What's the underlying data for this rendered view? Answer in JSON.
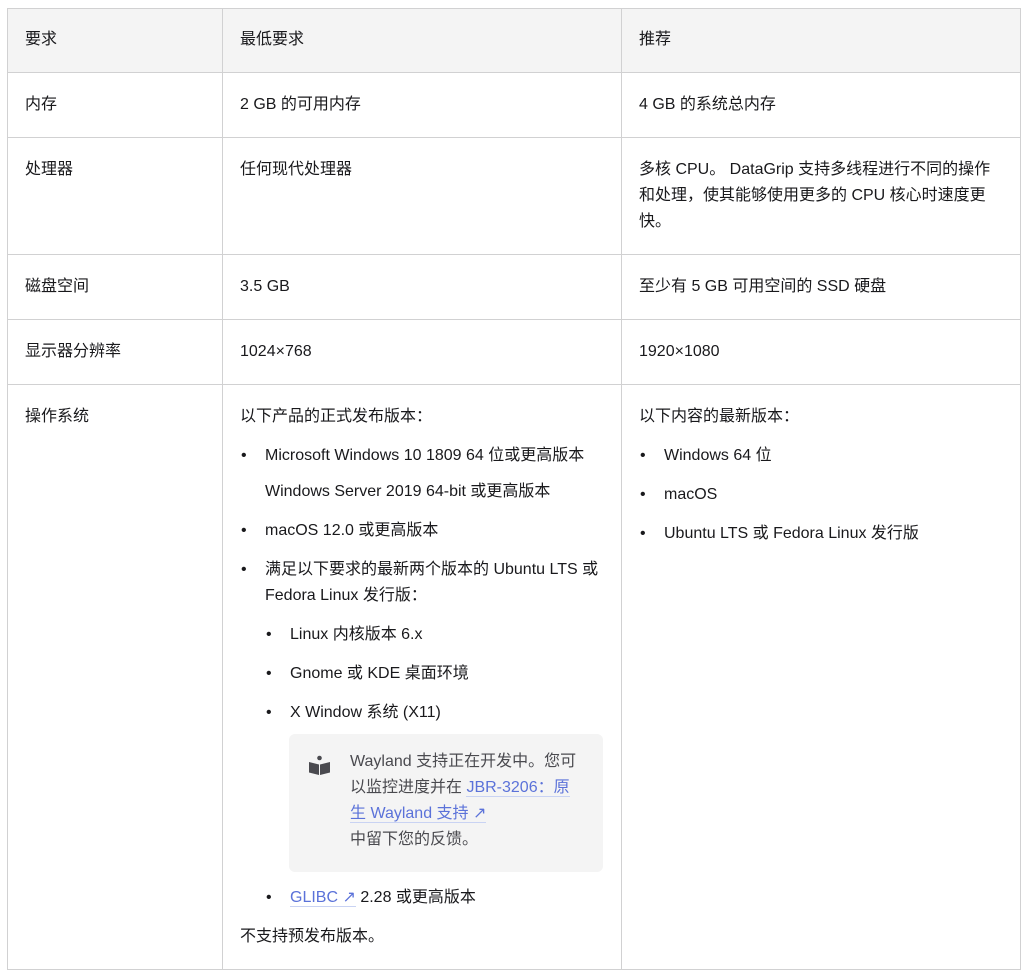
{
  "headers": [
    "要求",
    "最低要求",
    "推荐"
  ],
  "rows": [
    {
      "req": "内存",
      "min": "2 GB 的可用内存",
      "rec": "4 GB 的系统总内存"
    },
    {
      "req": "处理器",
      "min": "任何现代处理器",
      "rec": "多核 CPU。 DataGrip 支持多线程进行不同的操作和处理，使其能够使用更多的 CPU 核心时速度更快。"
    },
    {
      "req": "磁盘空间",
      "min": "3.5 GB",
      "rec": "至少有 5 GB 可用空间的 SSD 硬盘"
    },
    {
      "req": "显示器分辨率",
      "min": "1024×768",
      "rec": "1920×1080"
    }
  ],
  "os": {
    "req": "操作系统",
    "min_intro": "以下产品的正式发布版本：",
    "min_items": [
      "Microsoft Windows 10 1809 64 位或更高版本",
      "Windows Server 2019 64-bit 或更高版本",
      "macOS 12.0 或更高版本",
      "满足以下要求的最新两个版本的 Ubuntu LTS 或 Fedora Linux 发行版："
    ],
    "linux_items": [
      "Linux 内核版本 6.x",
      "Gnome 或 KDE 桌面环境",
      "X Window 系统 (X11)"
    ],
    "note_text1": "Wayland 支持正在开发中。您可以监控进度并在 ",
    "note_link": "JBR-3206：原生 Wayland 支持 ↗",
    "note_text2": "中留下您的反馈。",
    "glibc_link": "GLIBC ↗",
    "glibc_text": " 2.28 或更高版本",
    "min_footer": "不支持预发布版本。",
    "rec_intro": "以下内容的最新版本：",
    "rec_items": [
      "Windows 64 位",
      "macOS",
      "Ubuntu LTS 或 Fedora Linux 发行版"
    ]
  }
}
